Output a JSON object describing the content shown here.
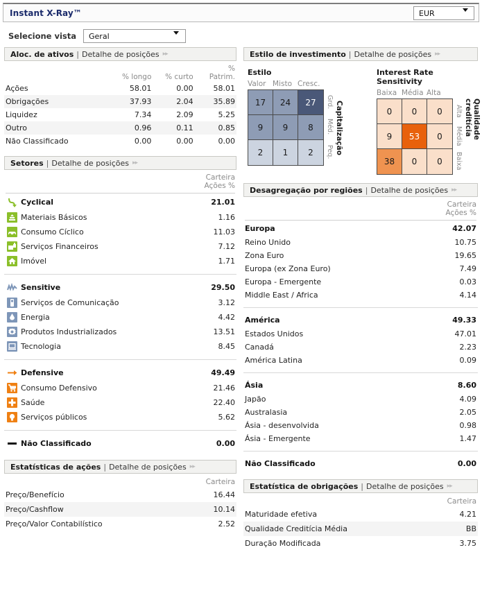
{
  "header": {
    "title": "Instant X-Ray™",
    "currency_value": "EUR",
    "currency_icon": "chevron-down-icon"
  },
  "view_selector": {
    "label": "Selecione vista",
    "value": "Geral",
    "icon": "chevron-down-icon"
  },
  "panels": {
    "asset_alloc": {
      "title": "Aloc. de ativos",
      "separator": "|",
      "link": "Detalhe de posições",
      "arrows": "▸▸",
      "columns": [
        "",
        "% longo",
        "% curto",
        "%",
        "Patrim."
      ],
      "headers": {
        "c1": "",
        "c2": "% longo",
        "c3": "% curto",
        "c4a": "%",
        "c4b": "Patrim."
      },
      "rows": [
        {
          "name": "Ações",
          "long": "58.01",
          "short": "0.00",
          "net": "58.01"
        },
        {
          "name": "Obrigações",
          "long": "37.93",
          "short": "2.04",
          "net": "35.89"
        },
        {
          "name": "Liquidez",
          "long": "7.34",
          "short": "2.09",
          "net": "5.25"
        },
        {
          "name": "Outro",
          "long": "0.96",
          "short": "0.11",
          "net": "0.85"
        },
        {
          "name": "Não Classificado",
          "long": "0.00",
          "short": "0.00",
          "net": "0.00"
        }
      ]
    },
    "style": {
      "title": "Estilo de investimento",
      "separator": "|",
      "link": "Detalhe de posições",
      "arrows": "▸▸",
      "equity": {
        "title": "Estilo",
        "col_labels": [
          "Valor",
          "Misto",
          "Cresc."
        ],
        "row_labels": [
          "Grd.",
          "Méd.",
          "Peq."
        ],
        "axis_label": "Capitalização",
        "cells": [
          17,
          24,
          27,
          9,
          9,
          8,
          2,
          1,
          2
        ]
      },
      "fixed_income": {
        "title": "Interest Rate Sensitivity",
        "col_labels": [
          "Baixa",
          "Média",
          "Alta"
        ],
        "row_labels": [
          "Alta",
          "Média",
          "Baixa"
        ],
        "axis_label": "Qualidade creditícia",
        "cells": [
          0,
          0,
          0,
          9,
          53,
          0,
          38,
          0,
          0
        ]
      }
    },
    "sectors": {
      "title": "Setores",
      "separator": "|",
      "link": "Detalhe de posições",
      "arrows": "▸▸",
      "col_header_1": "Carteira",
      "col_header_2": "Ações %",
      "groups": [
        {
          "name": "Cyclical",
          "value": "21.01",
          "icon": "cyclical-arrow-icon",
          "color": "#8bbf2a",
          "items": [
            {
              "name": "Materiais Básicos",
              "value": "1.16",
              "icon": "basic-materials-icon"
            },
            {
              "name": "Consumo Cíclico",
              "value": "11.03",
              "icon": "consumer-cyclical-car-icon"
            },
            {
              "name": "Serviços Financeiros",
              "value": "7.12",
              "icon": "financial-services-icon"
            },
            {
              "name": "Imóvel",
              "value": "1.71",
              "icon": "real-estate-house-icon"
            }
          ]
        },
        {
          "name": "Sensitive",
          "value": "29.50",
          "icon": "sensitive-wave-icon",
          "color": "#7e96b8",
          "items": [
            {
              "name": "Serviços de Comunicação",
              "value": "3.12",
              "icon": "communication-phone-icon"
            },
            {
              "name": "Energia",
              "value": "4.42",
              "icon": "energy-flame-icon"
            },
            {
              "name": "Produtos Industrializados",
              "value": "13.51",
              "icon": "industrials-gear-icon"
            },
            {
              "name": "Tecnologia",
              "value": "8.45",
              "icon": "technology-computer-icon"
            }
          ]
        },
        {
          "name": "Defensive",
          "value": "49.49",
          "icon": "defensive-arrow-icon",
          "color": "#ef8013",
          "items": [
            {
              "name": "Consumo Defensivo",
              "value": "21.46",
              "icon": "consumer-defensive-cart-icon"
            },
            {
              "name": "Saúde",
              "value": "22.40",
              "icon": "healthcare-cross-icon"
            },
            {
              "name": "Serviços públicos",
              "value": "5.62",
              "icon": "utilities-bulb-icon"
            }
          ]
        },
        {
          "name": "Não Classificado",
          "value": "0.00",
          "icon": "unclassified-dash-icon",
          "color": "#111111",
          "items": []
        }
      ]
    },
    "regions": {
      "title": "Desagregação por regiões",
      "separator": "|",
      "link": "Detalhe de posições",
      "arrows": "▸▸",
      "col_header_1": "Carteira",
      "col_header_2": "Ações %",
      "groups": [
        {
          "name": "Europa",
          "value": "42.07",
          "items": [
            {
              "name": "Reino Unido",
              "value": "10.75"
            },
            {
              "name": "Zona Euro",
              "value": "19.65"
            },
            {
              "name": "Europa (ex Zona Euro)",
              "value": "7.49"
            },
            {
              "name": "Europa - Emergente",
              "value": "0.03"
            },
            {
              "name": "Middle East / Africa",
              "value": "4.14"
            }
          ]
        },
        {
          "name": "América",
          "value": "49.33",
          "items": [
            {
              "name": "Estados Unidos",
              "value": "47.01"
            },
            {
              "name": "Canadá",
              "value": "2.23"
            },
            {
              "name": "América Latina",
              "value": "0.09"
            }
          ]
        },
        {
          "name": "Ásia",
          "value": "8.60",
          "items": [
            {
              "name": "Japão",
              "value": "4.09"
            },
            {
              "name": "Australasia",
              "value": "2.05"
            },
            {
              "name": "Ásia - desenvolvida",
              "value": "0.98"
            },
            {
              "name": "Ásia - Emergente",
              "value": "1.47"
            }
          ]
        },
        {
          "name": "Não Classificado",
          "value": "0.00",
          "items": []
        }
      ]
    },
    "equity_stats": {
      "title": "Estatísticas de ações",
      "separator": "|",
      "link": "Detalhe de posições",
      "arrows": "▸▸",
      "col_header": "Carteira",
      "rows": [
        {
          "name": "Preço/Benefício",
          "value": "16.44"
        },
        {
          "name": "Preço/Cashflow",
          "value": "10.14"
        },
        {
          "name": "Preço/Valor Contabilístico",
          "value": "2.52"
        }
      ]
    },
    "bond_stats": {
      "title": "Estatística de obrigações",
      "separator": "|",
      "link": "Detalhe de posições",
      "arrows": "▸▸",
      "col_header": "Carteira",
      "rows": [
        {
          "name": "Maturidade efetiva",
          "value": "4.21"
        },
        {
          "name": "Qualidade Creditícia Média",
          "value": "BB"
        },
        {
          "name": "Duração Modificada",
          "value": "3.75"
        }
      ]
    }
  },
  "colors": {
    "header_text": "#1b2b6b",
    "cyclical": "#8bbf2a",
    "sensitive": "#7e96b8",
    "defensive": "#ef8013",
    "style_max": "#4a5878",
    "style_mid": "#8e9cb5",
    "style_low": "#ccd4e0",
    "bond_max": "#e8610c",
    "bond_mid": "#ef9350",
    "bond_low": "#fadfca"
  }
}
